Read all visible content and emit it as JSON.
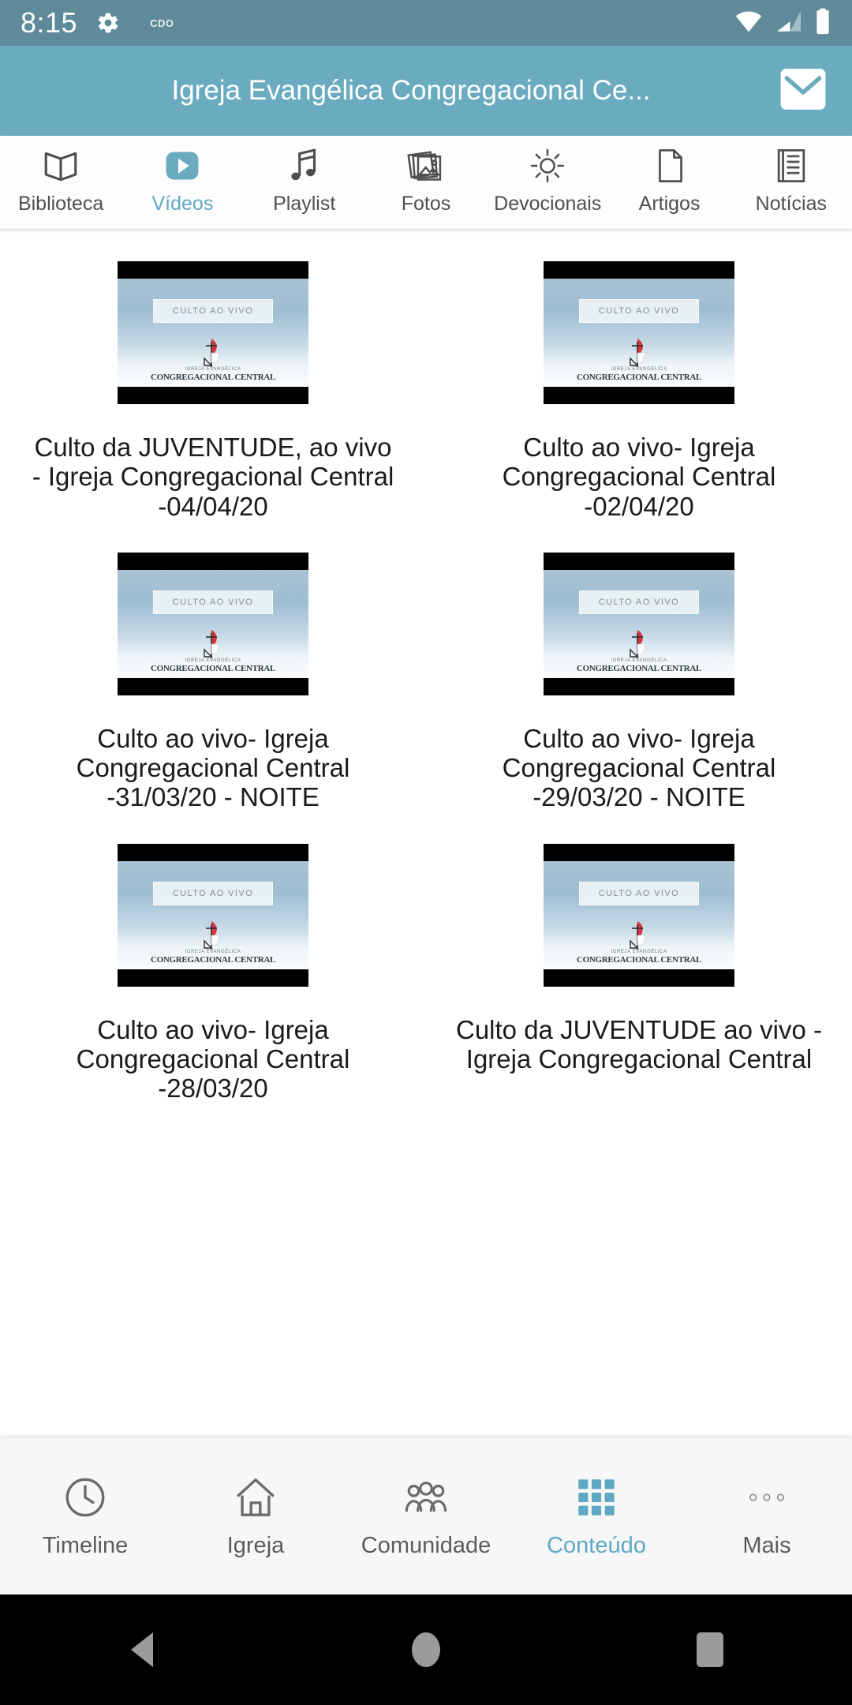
{
  "status_bar": {
    "time": "8:15",
    "carrier": "CDO",
    "icons": [
      "gear-icon",
      "wifi-icon",
      "cell-signal-icon",
      "battery-icon"
    ]
  },
  "header": {
    "title": "Igreja Evangélica Congregacional Ce...",
    "mail_icon": "envelope-icon",
    "background": "#6aabc0"
  },
  "tabs": [
    {
      "label": "Biblioteca",
      "icon": "open-book-icon",
      "active": false
    },
    {
      "label": "Vídeos",
      "icon": "play-video-icon",
      "active": true
    },
    {
      "label": "Playlist",
      "icon": "music-note-icon",
      "active": false
    },
    {
      "label": "Fotos",
      "icon": "photos-icon",
      "active": false
    },
    {
      "label": "Devocionais",
      "icon": "sun-icon",
      "active": false
    },
    {
      "label": "Artigos",
      "icon": "document-icon",
      "active": false
    },
    {
      "label": "Notícias",
      "icon": "news-icon",
      "active": false
    }
  ],
  "thumbnail": {
    "overlay_text": "CULTO AO VIVO",
    "brand_top": "IGREJA EVANGÉLICA",
    "brand_main": "CONGREGACIONAL CENTRAL"
  },
  "videos": [
    {
      "title": "Culto da JUVENTUDE, ao vivo - Igreja Congregacional Central -04/04/20"
    },
    {
      "title": "Culto ao vivo- Igreja Congregacional Central -02/04/20"
    },
    {
      "title": "Culto ao vivo- Igreja Congregacional Central -31/03/20 - NOITE"
    },
    {
      "title": "Culto ao vivo- Igreja Congregacional Central -29/03/20 - NOITE"
    },
    {
      "title": "Culto ao vivo- Igreja Congregacional Central -28/03/20"
    },
    {
      "title": "Culto da JUVENTUDE ao vivo - Igreja Congregacional Central"
    }
  ],
  "bottom_nav": [
    {
      "label": "Timeline",
      "icon": "clock-icon",
      "active": false
    },
    {
      "label": "Igreja",
      "icon": "house-icon",
      "active": false
    },
    {
      "label": "Comunidade",
      "icon": "people-icon",
      "active": false
    },
    {
      "label": "Conteúdo",
      "icon": "grid-icon",
      "active": true
    },
    {
      "label": "Mais",
      "icon": "more-dots-icon",
      "active": false
    }
  ],
  "system_nav": [
    {
      "icon": "back-triangle-icon"
    },
    {
      "icon": "home-circle-icon"
    },
    {
      "icon": "recents-square-icon"
    }
  ],
  "colors": {
    "accent": "#5ea8c4",
    "header": "#6aabc0",
    "status_bar": "#5e8a99"
  }
}
